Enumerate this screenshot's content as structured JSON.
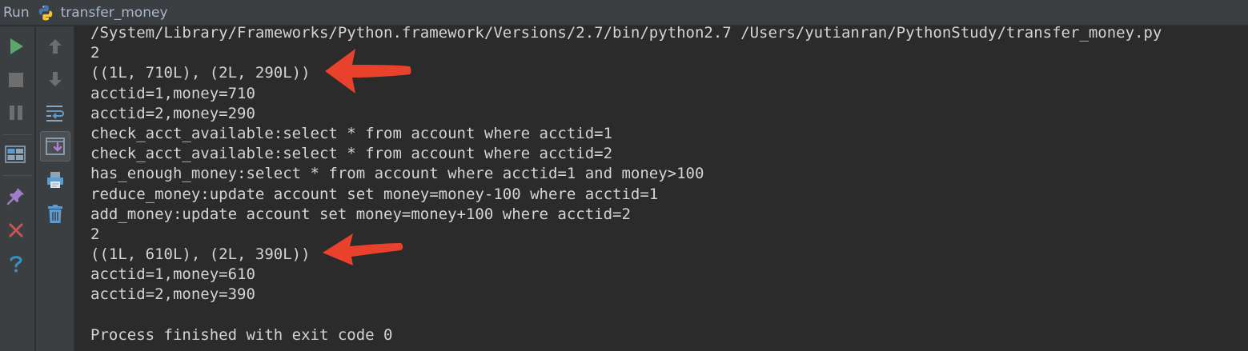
{
  "header": {
    "run_label": "Run",
    "config_name": "transfer_money",
    "config_icon": "python-icon"
  },
  "toolbar_left": {
    "buttons": [
      {
        "icon": "play-icon",
        "color": "#59a869"
      },
      {
        "icon": "stop-icon",
        "color": "#6e6e6e"
      },
      {
        "icon": "pause-icon",
        "color": "#6e6e6e"
      },
      {
        "icon": "layout-icon",
        "color": "#a9b7c6"
      },
      {
        "icon": "pin-icon",
        "color": "#b07fd6"
      },
      {
        "icon": "close-icon",
        "color": "#c75450"
      },
      {
        "icon": "help-icon",
        "color": "#3592c4"
      }
    ]
  },
  "toolbar_mid": {
    "buttons": [
      {
        "icon": "arrow-up-icon"
      },
      {
        "icon": "arrow-down-icon"
      },
      {
        "icon": "soft-wrap-icon"
      },
      {
        "icon": "scroll-to-end-icon"
      },
      {
        "icon": "print-icon"
      },
      {
        "icon": "trash-icon"
      }
    ]
  },
  "console": {
    "text_color": "#d4d4d4",
    "background": "#2b2b2b",
    "lines": [
      "/System/Library/Frameworks/Python.framework/Versions/2.7/bin/python2.7 /Users/yutianran/PythonStudy/transfer_money.py",
      "2",
      "((1L, 710L), (2L, 290L))",
      "acctid=1,money=710",
      "acctid=2,money=290",
      "check_acct_available:select * from account where acctid=1",
      "check_acct_available:select * from account where acctid=2",
      "has_enough_money:select * from account where acctid=1 and money>100",
      "reduce_money:update account set money=money-100 where acctid=1",
      "add_money:update account set money=money+100 where acctid=2",
      "2",
      "((1L, 610L), (2L, 390L))",
      "acctid=1,money=610",
      "acctid=2,money=390",
      "",
      "Process finished with exit code 0"
    ]
  },
  "annotations": {
    "arrow_color": "#e8412c"
  }
}
